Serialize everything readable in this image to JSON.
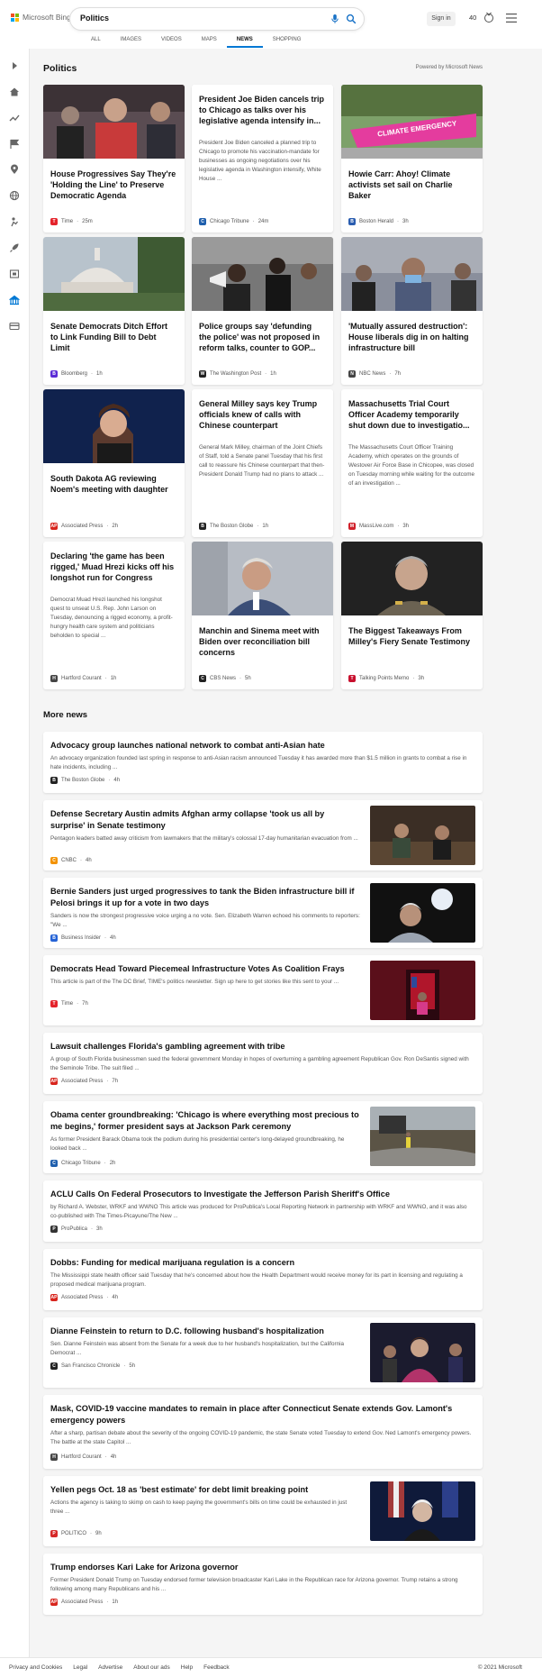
{
  "header": {
    "brand": "Microsoft Bing",
    "search_query": "Politics",
    "signin_label": "Sign in",
    "points": "40",
    "tabs": [
      "ALL",
      "IMAGES",
      "VIDEOS",
      "MAPS",
      "NEWS",
      "SHOPPING"
    ],
    "active_tab": "NEWS"
  },
  "section": {
    "title": "Politics",
    "powered_by": "Powered by Microsoft News"
  },
  "cards": [
    {
      "title": "House Progressives Say They're 'Holding the Line' to Preserve Democratic Agenda",
      "snippet": "",
      "source": "Time",
      "age": "25m",
      "icon_color": "#e4232b",
      "icon_letter": "T",
      "image_colors": [
        "#5a4c52",
        "#c83a3a"
      ]
    },
    {
      "title": "President Joe Biden cancels trip to Chicago as talks over his legislative agenda intensify in...",
      "snippet": "President Joe Biden canceled a planned trip to Chicago to promote his vaccination-mandate for businesses as ongoing negotiations over his legislative agenda in Washington intensify, White House ...",
      "source": "Chicago Tribune",
      "age": "24m",
      "icon_color": "#1f5fad",
      "icon_letter": "C"
    },
    {
      "title": "Howie Carr: Ahoy! Climate activists set sail on Charlie Baker",
      "snippet": "",
      "source": "Boston Herald",
      "age": "3h",
      "icon_color": "#2a5db0",
      "icon_letter": "B",
      "image_colors": [
        "#7da16a",
        "#e43c9e"
      ],
      "image_text": "CLIMATE EMERGENCY"
    },
    {
      "title": "Senate Democrats Ditch Effort to Link Funding Bill to Debt Limit",
      "snippet": "",
      "source": "Bloomberg",
      "age": "1h",
      "icon_color": "#5a2bd6",
      "icon_letter": "B",
      "image_colors": [
        "#b8c3cc",
        "#3e5a33"
      ]
    },
    {
      "title": "Police groups say 'defunding the police' was not proposed in reform talks, counter to GOP...",
      "snippet": "",
      "source": "The Washington Post",
      "age": "1h",
      "icon_color": "#222222",
      "icon_letter": "W",
      "image_colors": [
        "#3d3d3d",
        "#777777"
      ]
    },
    {
      "title": "'Mutually assured destruction': House liberals dig in on halting infrastructure bill",
      "snippet": "",
      "source": "NBC News",
      "age": "7h",
      "icon_color": "#444444",
      "icon_letter": "N",
      "image_colors": [
        "#4d5a7a",
        "#8a8f9c"
      ]
    },
    {
      "title": "South Dakota AG reviewing Noem's meeting with daughter",
      "snippet": "",
      "source": "Associated Press",
      "age": "2h",
      "icon_color": "#d8251d",
      "icon_letter": "AP",
      "image_colors": [
        "#10224d",
        "#7a3c33"
      ]
    },
    {
      "title": "General Milley says key Trump officials knew of calls with Chinese counterpart",
      "snippet": "General Mark Milley, chairman of the Joint Chiefs of Staff, told a Senate panel Tuesday that his first call to reassure his Chinese counterpart that then-President Donald Trump had no plans to attack ...",
      "source": "The Boston Globe",
      "age": "1h",
      "icon_color": "#222222",
      "icon_letter": "B"
    },
    {
      "title": "Massachusetts Trial Court Officer Academy temporarily shut down due to investigatio...",
      "snippet": "The Massachusetts Court Officer Training Academy, which operates on the grounds of Westover Air Force Base in Chicopee, was closed on Tuesday morning while waiting for the outcome of an investigation ...",
      "source": "MassLive.com",
      "age": "3h",
      "icon_color": "#d0202a",
      "icon_letter": "M"
    },
    {
      "title": "Declaring 'the game has been rigged,' Muad Hrezi kicks off his longshot run for Congress",
      "snippet": "Democrat Muad Hrezi launched his longshot quest to unseat U.S. Rep. John Larson on Tuesday, denouncing a rigged economy, a profit-hungry health care system and politicians beholden to special ...",
      "source": "Hartford Courant",
      "age": "1h",
      "icon_color": "#444444",
      "icon_letter": "H"
    },
    {
      "title": "Manchin and Sinema meet with Biden over reconciliation bill concerns",
      "snippet": "",
      "source": "CBS News",
      "age": "5h",
      "icon_color": "#222222",
      "icon_letter": "C",
      "image_colors": [
        "#b7bcc4",
        "#3b4e77"
      ]
    },
    {
      "title": "The Biggest Takeaways From Milley's Fiery Senate Testimony",
      "snippet": "",
      "source": "Talking Points Memo",
      "age": "3h",
      "icon_color": "#c8102e",
      "icon_letter": "T",
      "image_colors": [
        "#222222",
        "#6b6252"
      ]
    }
  ],
  "more_news": {
    "title": "More news",
    "items": [
      {
        "title": "Advocacy group launches national network to combat anti-Asian hate",
        "snippet": "An advocacy organization founded last spring in response to anti-Asian racism announced Tuesday it has awarded more than $1.5 million in grants to combat a rise in hate incidents, including ...",
        "source": "The Boston Globe",
        "age": "4h",
        "icon_color": "#222222",
        "icon_letter": "B"
      },
      {
        "title": "Defense Secretary Austin admits Afghan army collapse 'took us all by surprise' in Senate testimony",
        "snippet": "Pentagon leaders batted away criticism from lawmakers that the military's colossal 17-day humanitarian evacuation from ...",
        "source": "CNBC",
        "age": "4h",
        "icon_color": "#f39200",
        "icon_letter": "C",
        "image_colors": [
          "#3b2e25",
          "#6d5a45"
        ]
      },
      {
        "title": "Bernie Sanders just urged progressives to tank the Biden infrastructure bill if Pelosi brings it up for a vote in two days",
        "snippet": "Sanders is now the strongest progressive voice urging a no vote. Sen. Elizabeth Warren echoed his comments to reporters: \"We ...",
        "source": "Business Insider",
        "age": "4h",
        "icon_color": "#2563d6",
        "icon_letter": "B",
        "image_colors": [
          "#111111",
          "#9aa3b0"
        ]
      },
      {
        "title": "Democrats Head Toward Piecemeal Infrastructure Votes As Coalition Frays",
        "snippet": "This article is part of the The DC Brief, TIME's politics newsletter. Sign up here to get stories like this sent to your ...",
        "source": "Time",
        "age": "7h",
        "icon_color": "#e4232b",
        "icon_letter": "T",
        "image_colors": [
          "#5a0f1a",
          "#b0162b"
        ]
      },
      {
        "title": "Lawsuit challenges Florida's gambling agreement with tribe",
        "snippet": "A group of South Florida businessmen sued the federal government Monday in hopes of overturning a gambling agreement Republican Gov. Ron DeSantis signed with the Seminole Tribe. The suit filed ...",
        "source": "Associated Press",
        "age": "7h",
        "icon_color": "#d8251d",
        "icon_letter": "AP"
      },
      {
        "title": "Obama center groundbreaking: 'Chicago is where everything most precious to me begins,' former president says at Jackson Park ceremony",
        "snippet": "As former President Barack Obama took the podium during his presidential center's long-delayed groundbreaking, he looked back ...",
        "source": "Chicago Tribune",
        "age": "2h",
        "icon_color": "#1f5fad",
        "icon_letter": "C",
        "image_colors": [
          "#8c8a85",
          "#5b5446"
        ]
      },
      {
        "title": "ACLU Calls On Federal Prosecutors to Investigate the Jefferson Parish Sheriff's Office",
        "snippet": "by Richard A. Webster, WRKF and WWNO This article was produced for ProPublica's Local Reporting Network in partnership with WRKF and WWNO, and it was also co-published with The Times-Picayune/The New ...",
        "source": "ProPublica",
        "age": "3h",
        "icon_color": "#333333",
        "icon_letter": "P"
      },
      {
        "title": "Dobbs: Funding for medical marijuana regulation is a concern",
        "snippet": "The Mississippi state health officer said Tuesday that he's concerned about how the Health Department would receive money for its part in licensing and regulating a proposed medical marijuana program.",
        "source": "Associated Press",
        "age": "4h",
        "icon_color": "#d8251d",
        "icon_letter": "AP"
      },
      {
        "title": "Dianne Feinstein to return to D.C. following husband's hospitalization",
        "snippet": "Sen. Dianne Feinstein was absent from the Senate for a week due to her husband's hospitalization, but the California Democrat ...",
        "source": "San Francisco Chronicle",
        "age": "5h",
        "icon_color": "#222222",
        "icon_letter": "C",
        "image_colors": [
          "#1b1b2e",
          "#b2336a"
        ]
      },
      {
        "title": "Mask, COVID-19 vaccine mandates to remain in place after Connecticut Senate extends Gov. Lamont's emergency powers",
        "snippet": "After a sharp, partisan debate about the severity of the ongoing COVID-19 pandemic, the state Senate voted Tuesday to extend Gov. Ned Lamont's emergency powers. The battle at the state Capitol ...",
        "source": "Hartford Courant",
        "age": "4h",
        "icon_color": "#444444",
        "icon_letter": "H"
      },
      {
        "title": "Yellen pegs Oct. 18 as 'best estimate' for debt limit breaking point",
        "snippet": "Actions the agency is taking to skimp on cash to keep paying the government's bills on time could be exhausted in just three ...",
        "source": "POLITICO",
        "age": "9h",
        "icon_color": "#d62828",
        "icon_letter": "P",
        "image_colors": [
          "#0f1a3a",
          "#a23a3a"
        ]
      },
      {
        "title": "Trump endorses Kari Lake for Arizona governor",
        "snippet": "Former President Donald Trump on Tuesday endorsed former television broadcaster Kari Lake in the Republican race for Arizona governor. Trump retains a strong following among many Republicans and his ...",
        "source": "Associated Press",
        "age": "1h",
        "icon_color": "#d8251d",
        "icon_letter": "AP"
      }
    ]
  },
  "footer": {
    "links": [
      "Privacy and Cookies",
      "Legal",
      "Advertise",
      "About our ads",
      "Help",
      "Feedback"
    ],
    "copyright": "© 2021 Microsoft"
  },
  "colors": {
    "accent": "#0078d4",
    "page_bg": "#f5f5f5",
    "rail_active": "#0078d4"
  }
}
